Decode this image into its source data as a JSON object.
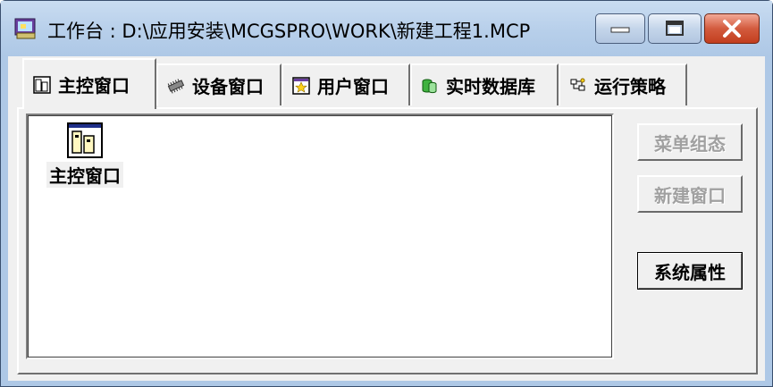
{
  "window": {
    "title": "工作台 : D:\\应用安装\\MCGSPRO\\WORK\\新建工程1.MCP",
    "controls": [
      "minimize",
      "maximize",
      "close"
    ]
  },
  "tabs": [
    {
      "label": "主控窗口",
      "icon": "main-window-icon",
      "active": true
    },
    {
      "label": "设备窗口",
      "icon": "device-chip-icon",
      "active": false
    },
    {
      "label": "用户窗口",
      "icon": "user-window-star-icon",
      "active": false
    },
    {
      "label": "实时数据库",
      "icon": "database-cylinder-icon",
      "active": false
    },
    {
      "label": "运行策略",
      "icon": "strategy-icon",
      "active": false
    }
  ],
  "list": {
    "items": [
      {
        "label": "主控窗口",
        "icon": "main-window-icon"
      }
    ]
  },
  "buttons": {
    "menu_config": "菜单组态",
    "new_window": "新建窗口",
    "system_properties": "系统属性"
  },
  "colors": {
    "titlebar": "#aec8e6",
    "close_button": "#c94a2c",
    "panel": "#f0f0f0",
    "disabled_text": "#a0a0a0"
  }
}
